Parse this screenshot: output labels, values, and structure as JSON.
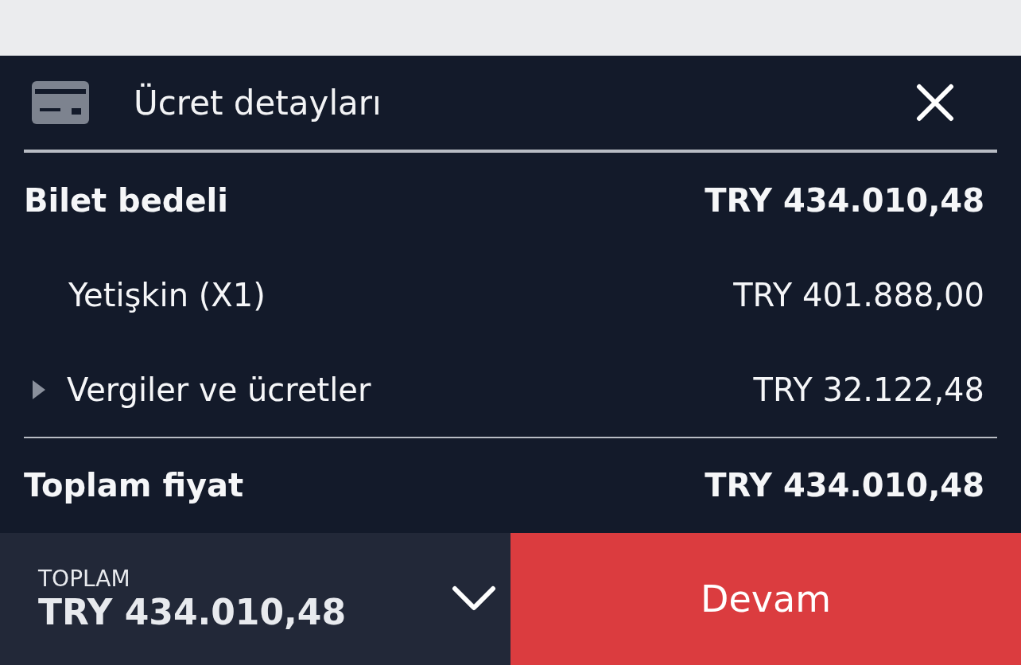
{
  "panel": {
    "title": "Ücret detayları"
  },
  "rows": [
    {
      "kind": "heading",
      "label": "Bilet bedeli",
      "amount": "TRY 434.010,48"
    },
    {
      "kind": "item",
      "label": "Yetişkin (X1)",
      "amount": "TRY 401.888,00"
    },
    {
      "kind": "expandable",
      "label": "Vergiler ve ücretler",
      "amount": "TRY 32.122,48",
      "expanded": false
    },
    {
      "kind": "total",
      "label": "Toplam fiyat",
      "amount": "TRY 434.010,48"
    }
  ],
  "footer": {
    "label": "TOPLAM",
    "amount": "TRY 434.010,48",
    "expanded": true,
    "button": "Devam"
  }
}
